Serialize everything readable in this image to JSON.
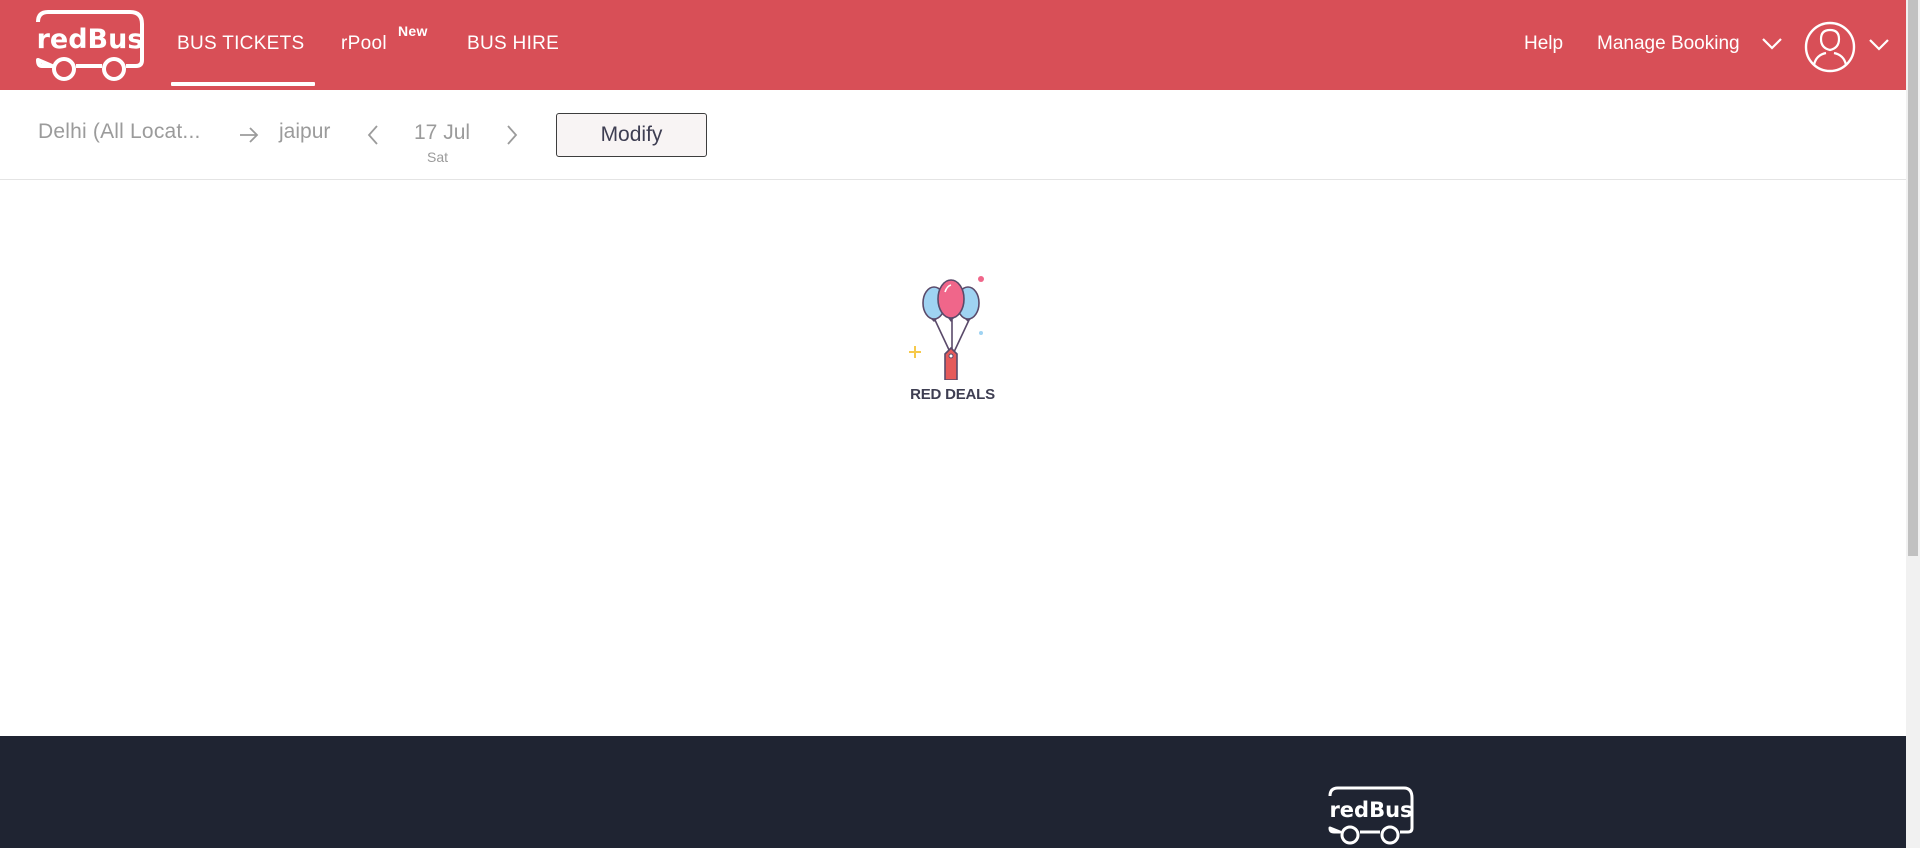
{
  "brand": {
    "logo_text": "redBus"
  },
  "colors": {
    "header_bg": "#d84f57",
    "footer_bg": "#1f2432",
    "text_muted": "#9b9b9b"
  },
  "nav": {
    "items": [
      {
        "label": "BUS TICKETS",
        "active": true
      },
      {
        "label": "rPool",
        "badge": "New",
        "active": false
      },
      {
        "label": "BUS HIRE",
        "active": false
      }
    ]
  },
  "header_right": {
    "help_label": "Help",
    "manage_booking_label": "Manage Booking",
    "profile_icon": "user-icon"
  },
  "search": {
    "source": "Delhi (All Locat...",
    "destination": "jaipur",
    "date": "17 Jul",
    "weekday": "Sat",
    "modify_label": "Modify"
  },
  "loader": {
    "caption": "RED DEALS",
    "icon": "balloon-tag-icon"
  },
  "footer": {
    "logo_text": "redBus"
  }
}
